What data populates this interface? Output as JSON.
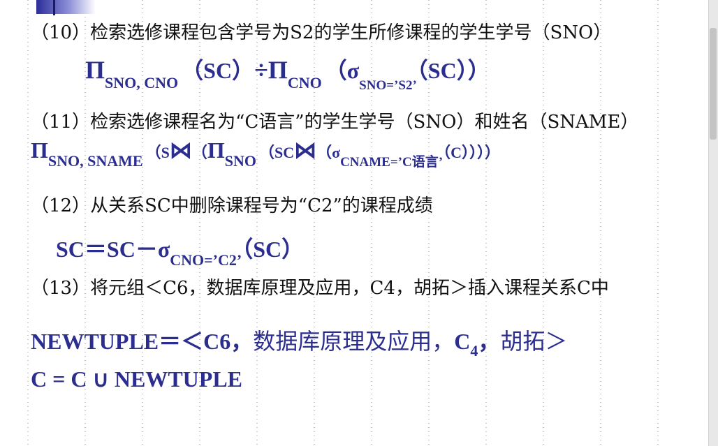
{
  "slide": {
    "lines": [
      {
        "id": "q10",
        "text": "（10）检索选修课程包含学号为S2的学生所修课程的学生学号（SNO）"
      },
      {
        "id": "q11",
        "text": "（11）检索选修课程名为“C语言”的学生学号（SNO）和姓名（SNAME）"
      },
      {
        "id": "q12",
        "text": "（12）从关系SC中删除课程号为“C2”的课程成绩"
      },
      {
        "id": "q13",
        "text": "（13）将元组＜C6，数据库原理及应用，C4，胡拓＞插入课程关系C中"
      }
    ],
    "f10": {
      "pi1": "Π",
      "sub1": "SNO, CNO",
      "sc1": "（SC）",
      "div": "÷",
      "pi2": "Π",
      "sub2": "CNO",
      "open": "（σ",
      "sub3": "SNO=’S2’",
      "sc2": "（SC））"
    },
    "f11": {
      "pi1": "Π",
      "sub1": "SNO, SNAME",
      "p1": "（S",
      "join1": "⋈",
      "p2": "（",
      "pi2": "Π",
      "sub2": "SNO",
      "p3": "（SC",
      "join2": "⋈",
      "p4": "（σ",
      "sub3": "CNAME=’C语言’",
      "p5": "（C））））"
    },
    "f12": {
      "lhs": "SC＝SC－σ",
      "sub": "CNO=’C2’",
      "rhs": "（SC）"
    },
    "f13a": {
      "pre": "NEWTUPLE＝＜C6，",
      "cn": "数据库原理及应用，",
      "c": "C",
      "sub": "4",
      "comma": "，",
      "cn2": "胡拓＞"
    },
    "f13b": {
      "text": "C = C ∪ NEWTUPLE"
    }
  },
  "colors": {
    "formula": "#2b2d8f",
    "text": "#111111",
    "grid": "#666666"
  }
}
